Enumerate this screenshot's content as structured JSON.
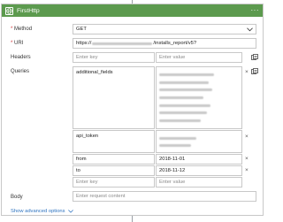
{
  "header": {
    "title": "FirstHttp",
    "more": "···",
    "bg_color": "#5c9a4e"
  },
  "method": {
    "label": "Method",
    "required_mark": "*",
    "value": "GET"
  },
  "uri": {
    "label": "URI",
    "required_mark": "*",
    "prefix": "https://",
    "suffix": "/installs_report/v5?"
  },
  "headers": {
    "label": "Headers",
    "key_placeholder": "Enter key",
    "value_placeholder": "Enter value"
  },
  "queries": {
    "label": "Queries",
    "rows": [
      {
        "key": "additional_fields",
        "value": ""
      },
      {
        "key": "api_token",
        "value": ""
      },
      {
        "key": "from",
        "value": "2018-11-01"
      },
      {
        "key": "to",
        "value": "2018-11-12"
      }
    ],
    "key_placeholder": "Enter key",
    "value_placeholder": "Enter value",
    "remove_glyph": "×"
  },
  "body": {
    "label": "Body",
    "placeholder": "Enter request content"
  },
  "advanced": {
    "label": "Show advanced options"
  }
}
